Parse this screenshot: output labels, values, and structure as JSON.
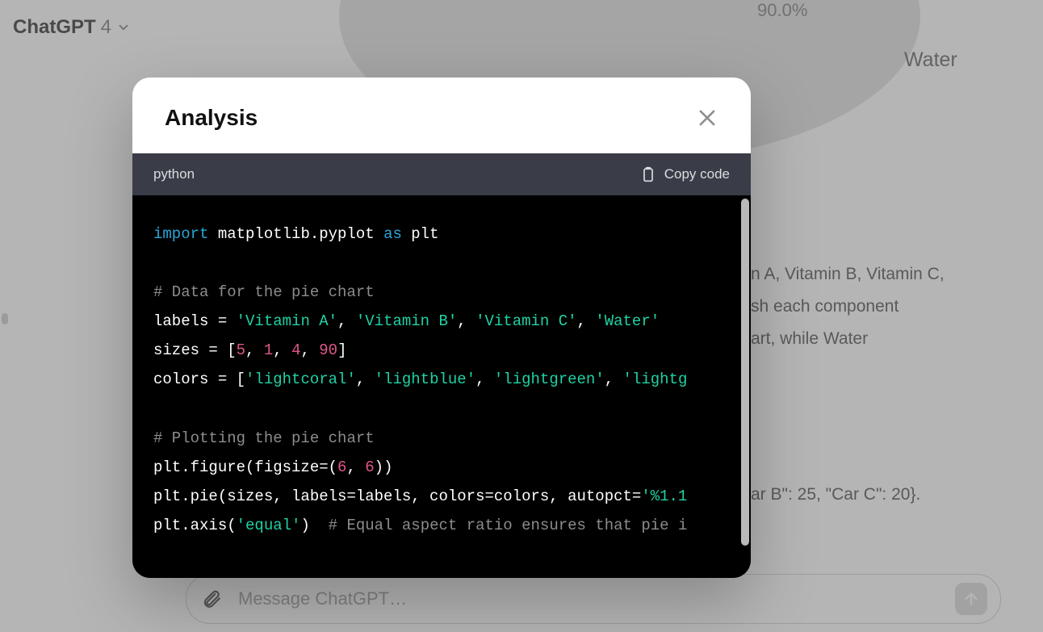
{
  "header": {
    "model_name": "ChatGPT",
    "model_version": "4"
  },
  "background": {
    "pie_pct": "90.0%",
    "pie_label": "Water",
    "para1_line1": "n A, Vitamin B, Vitamin C,",
    "para1_line2": "sh each component",
    "para1_line3": "art, while Water",
    "para2_line1": "ar B\": 25, \"Car C\": 20}."
  },
  "composer": {
    "placeholder": "Message ChatGPT…"
  },
  "modal": {
    "title": "Analysis",
    "code_lang": "python",
    "copy_label": "Copy code",
    "code": {
      "l1_kw": "import",
      "l1_mod": " matplotlib.pyplot ",
      "l1_as": "as",
      "l1_alias": " plt",
      "l3_cmt": "# Data for the pie chart",
      "l4_lhs": "labels = ",
      "l4_s1": "'Vitamin A'",
      "l4_s2": "'Vitamin B'",
      "l4_s3": "'Vitamin C'",
      "l4_s4": "'Water'",
      "l5_lhs": "sizes = [",
      "l5_n1": "5",
      "l5_n2": "1",
      "l5_n3": "4",
      "l5_n4": "90",
      "l5_end": "]",
      "l6_lhs": "colors = [",
      "l6_s1": "'lightcoral'",
      "l6_s2": "'lightblue'",
      "l6_s3": "'lightgreen'",
      "l6_s4": "'lightg",
      "l8_cmt": "# Plotting the pie chart",
      "l9_a": "plt.figure(figsize=(",
      "l9_n1": "6",
      "l9_n2": "6",
      "l9_b": "))",
      "l10_a": "plt.pie(sizes, labels=labels, colors=colors, autopct=",
      "l10_s": "'%1.1",
      "l11_a": "plt.axis(",
      "l11_s": "'equal'",
      "l11_b": ")  ",
      "l11_cmt": "# Equal aspect ratio ensures that pie i"
    }
  }
}
